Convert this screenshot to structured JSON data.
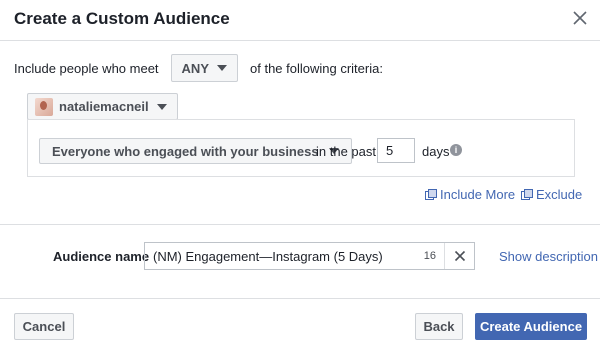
{
  "dialog": {
    "title": "Create a Custom Audience"
  },
  "criteria": {
    "prefix": "Include people who meet",
    "match_value": "ANY",
    "suffix": "of the following criteria:"
  },
  "account": {
    "name": "nataliemacneil"
  },
  "rule": {
    "engagement": "Everyone who engaged with your business",
    "in_the_past": "in the past",
    "days_value": "5",
    "days_label": "days"
  },
  "actions": {
    "include_more": "Include More",
    "exclude": "Exclude"
  },
  "audience": {
    "label": "Audience name",
    "value": "(NM) Engagement—Instagram (5 Days)",
    "char_count": "16",
    "show_description": "Show description"
  },
  "footer": {
    "cancel": "Cancel",
    "back": "Back",
    "create": "Create Audience"
  },
  "colors": {
    "accent": "#4267b2",
    "border": "#dddfe2",
    "text": "#1d2129"
  }
}
